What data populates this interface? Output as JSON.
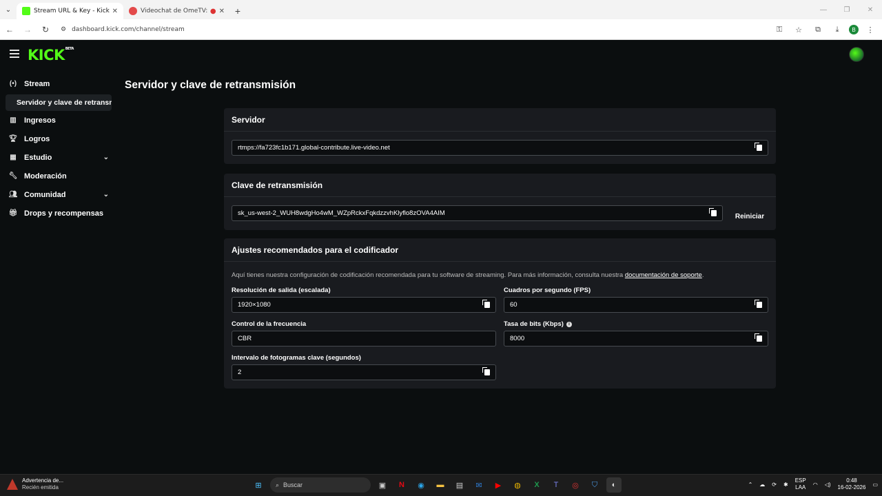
{
  "browser": {
    "tabs": [
      {
        "title": "Stream URL & Key - Kick Dashb",
        "color": "#53fc18",
        "active": true
      },
      {
        "title": "Videochat de OmeTV: altern",
        "color": "#e34a4a",
        "active": false
      }
    ],
    "new_tab": "+",
    "url": "dashboard.kick.com/channel/stream",
    "profile_initial": "B"
  },
  "app": {
    "logo": "KICK",
    "logo_badge": "BETA",
    "page_title": "Servidor y clave de retransmisión",
    "sidebar": {
      "items": [
        {
          "label": "Stream",
          "icon": "broadcast-icon"
        },
        {
          "label": "Ingresos",
          "icon": "chart-icon"
        },
        {
          "label": "Logros",
          "icon": "trophy-icon"
        },
        {
          "label": "Estudio",
          "icon": "studio-icon",
          "expandable": true
        },
        {
          "label": "Moderación",
          "icon": "wrench-icon"
        },
        {
          "label": "Comunidad",
          "icon": "people-icon",
          "expandable": true
        },
        {
          "label": "Drops y recompensas",
          "icon": "gift-icon"
        }
      ],
      "sub_item": "Servidor y clave de retransmisión"
    },
    "server_card": {
      "title": "Servidor",
      "value": "rtmps://fa723fc1b171.global-contribute.live-video.net"
    },
    "key_card": {
      "title": "Clave de retransmisión",
      "value": "sk_us-west-2_WUH8wdgHo4wM_WZpRckxFqkdzzvhKlyflo8zOVA4AIM",
      "reset_label": "Reiniciar"
    },
    "encoder_card": {
      "title": "Ajustes recomendados para el codificador",
      "description": "Aquí tienes nuestra configuración de codificación recomendada para tu software de streaming. Para más información, consulta nuestra ",
      "doc_link": "documentación de soporte",
      "doc_suffix": ".",
      "resolution": {
        "label": "Resolución de salida (escalada)",
        "value": "1920×1080"
      },
      "fps": {
        "label": "Cuadros por segundo (FPS)",
        "value": "60"
      },
      "rate_control": {
        "label": "Control de la frecuencia",
        "value": "CBR"
      },
      "bitrate": {
        "label": "Tasa de bits (Kbps)",
        "value": "8000"
      },
      "keyframe": {
        "label": "Intervalo de fotogramas clave (segundos)",
        "value": "2"
      }
    }
  },
  "taskbar": {
    "notification_title": "Advertencia de...",
    "notification_sub": "Recién emitida",
    "search_placeholder": "Buscar",
    "lang_top": "ESP",
    "lang_bottom": "LAA",
    "time": "0:48",
    "date": "16-02-2026"
  }
}
